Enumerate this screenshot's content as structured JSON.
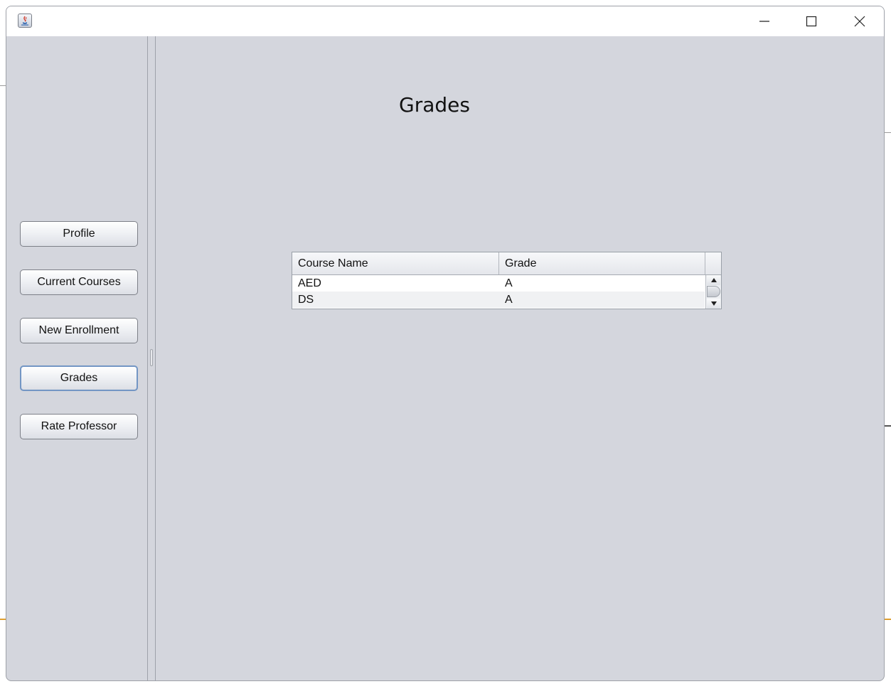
{
  "window": {
    "controls": {
      "minimize_icon": "minimize-icon",
      "maximize_icon": "maximize-icon",
      "close_icon": "close-icon"
    },
    "app_icon": "java-icon"
  },
  "sidebar": {
    "items": [
      {
        "label": "Profile",
        "active": false
      },
      {
        "label": "Current Courses",
        "active": false
      },
      {
        "label": "New Enrollment",
        "active": false
      },
      {
        "label": "Grades",
        "active": true
      },
      {
        "label": "Rate Professor",
        "active": false
      }
    ]
  },
  "main": {
    "title": "Grades",
    "table": {
      "columns": [
        "Course Name",
        "Grade"
      ],
      "rows": [
        [
          "AED",
          "A"
        ],
        [
          "DS",
          "A"
        ]
      ]
    }
  },
  "colors": {
    "background": "#d4d6dd",
    "active_border": "#7396c4"
  }
}
